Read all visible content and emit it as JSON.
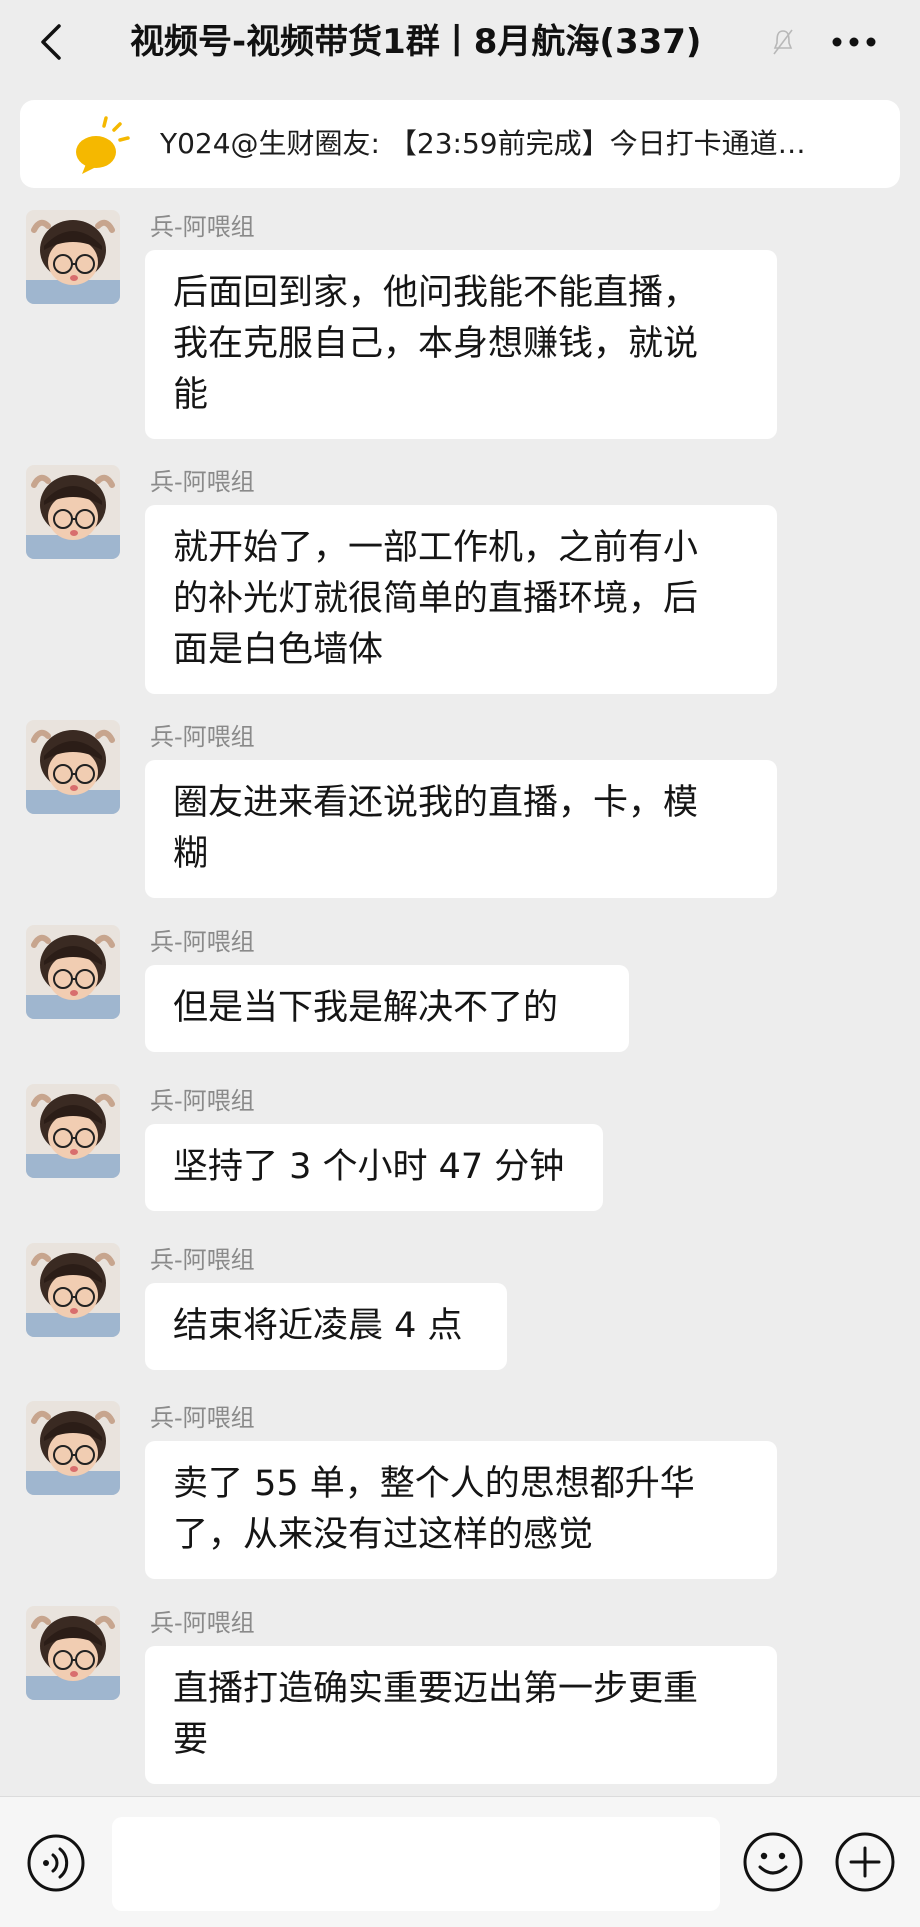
{
  "header": {
    "title": "视频号-视频带货1群丨8月航海(337)",
    "back_icon": "chevron-left-icon",
    "mute_icon": "mute-bell-icon",
    "more_icon": "more-dots-icon"
  },
  "pinned": {
    "icon": "lightbulb-icon",
    "text": "Y024@生财圈友: 【23:59前完成】今日打卡通道…"
  },
  "messages": [
    {
      "sender": "兵-阿喂组",
      "lines": [
        "后面回到家，他问我能不能直播，",
        "我在克服自己，本身想赚钱，就说",
        "能"
      ]
    },
    {
      "sender": "兵-阿喂组",
      "lines": [
        "就开始了，一部工作机，之前有小",
        "的补光灯就很简单的直播环境，后",
        "面是白色墙体"
      ]
    },
    {
      "sender": "兵-阿喂组",
      "lines": [
        "圈友进来看还说我的直播，卡，模",
        "糊"
      ]
    },
    {
      "sender": "兵-阿喂组",
      "lines": [
        "但是当下我是解决不了的"
      ]
    },
    {
      "sender": "兵-阿喂组",
      "lines": [
        "坚持了 3 个小时 47 分钟"
      ]
    },
    {
      "sender": "兵-阿喂组",
      "lines": [
        "结束将近凌晨 4 点"
      ]
    },
    {
      "sender": "兵-阿喂组",
      "lines": [
        "卖了 55 单，整个人的思想都升华",
        "了，从来没有过这样的感觉"
      ]
    },
    {
      "sender": "兵-阿喂组",
      "lines": [
        "直播打造确实重要迈出第一步更重",
        "要"
      ]
    }
  ],
  "input_bar": {
    "voice_icon": "voice-icon",
    "emoji_icon": "emoji-icon",
    "plus_icon": "plus-icon",
    "input_value": ""
  },
  "colors": {
    "background": "#ededed",
    "bubble": "#ffffff",
    "sender_text": "#8a8a8a",
    "bulb": "#f5b800"
  }
}
